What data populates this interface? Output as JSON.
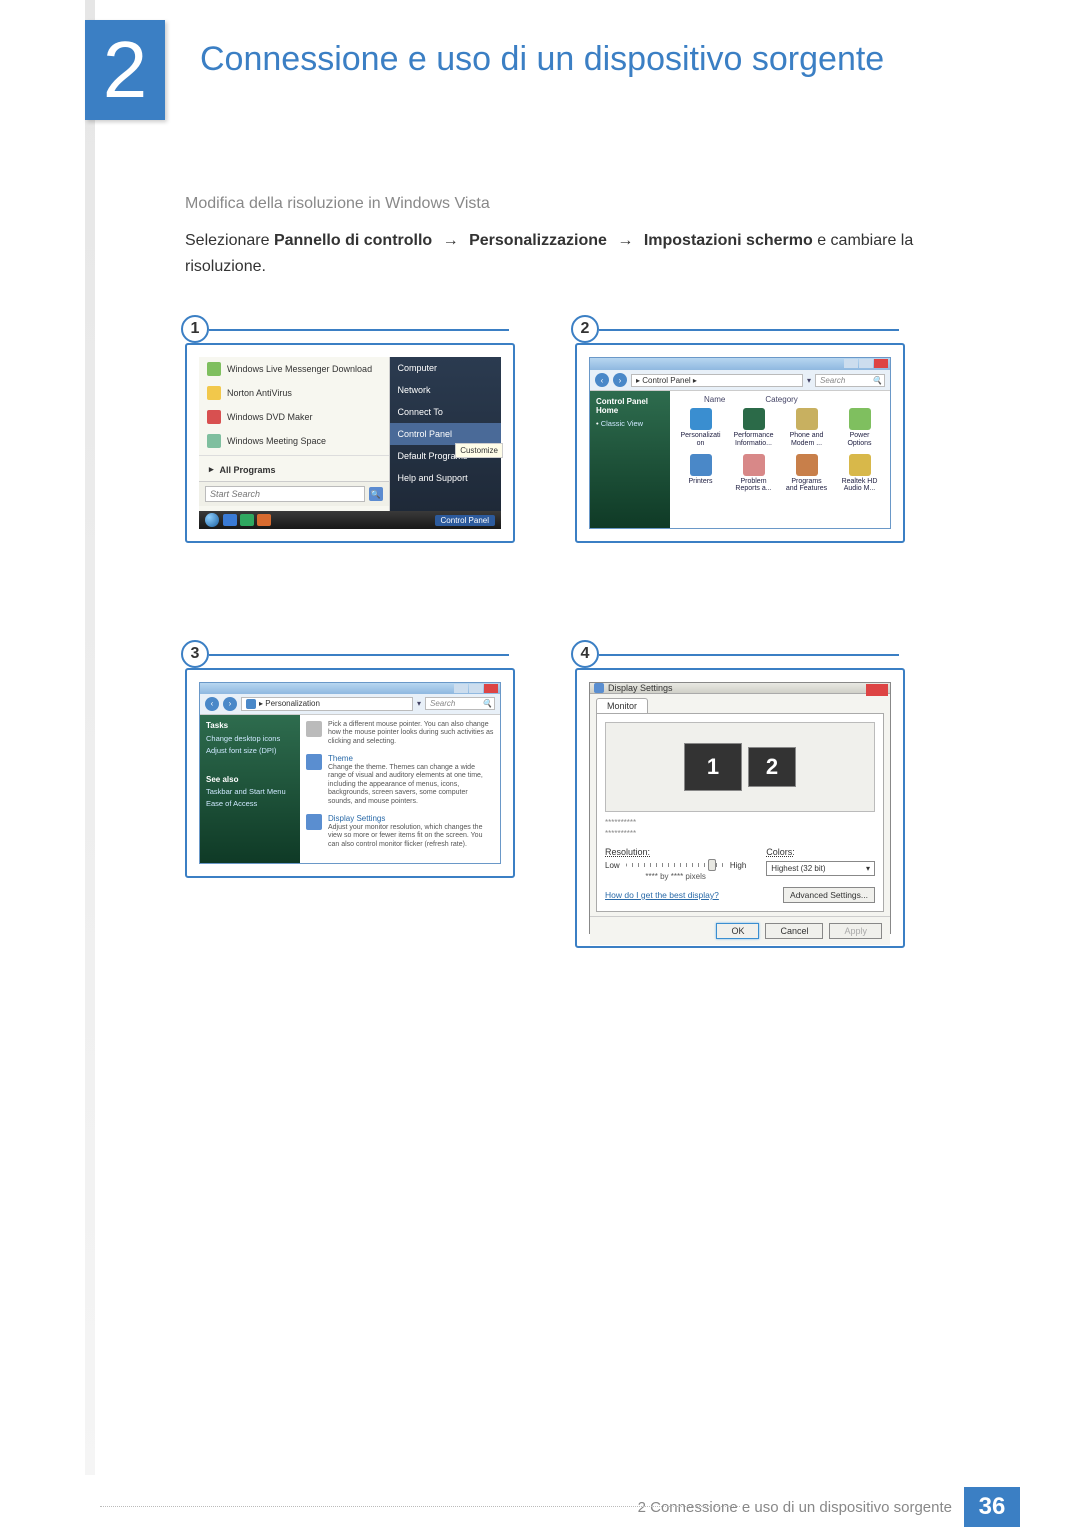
{
  "chapter": {
    "number": "2",
    "title": "Connessione e uso di un dispositivo sorgente"
  },
  "section": {
    "subhead": "Modifica della risoluzione in Windows Vista",
    "text_pre": "Selezionare ",
    "path1": "Pannello di controllo",
    "path2": "Personalizzazione",
    "path3": "Impostazioni schermo",
    "text_post": " e cambiare la risoluzione.",
    "arrow": "→"
  },
  "steps": {
    "s1": "1",
    "s2": "2",
    "s3": "3",
    "s4": "4"
  },
  "fig1": {
    "apps": [
      {
        "name": "Windows Live Messenger Download",
        "color": "#7fbf5f"
      },
      {
        "name": "Norton AntiVirus",
        "color": "#f2c84b"
      },
      {
        "name": "Windows DVD Maker",
        "color": "#d85050"
      },
      {
        "name": "Windows Meeting Space",
        "color": "#7fbf9f"
      }
    ],
    "all_programs": "All Programs",
    "search_placeholder": "Start Search",
    "right_items": [
      "Computer",
      "Network",
      "Connect To",
      "Control Panel",
      "Default Programs",
      "Help and Support"
    ],
    "right_highlight_index": 3,
    "tooltip_text": "Customize",
    "taskbar_label": "Control Panel",
    "tb_colors": [
      "#3a7bd5",
      "#2fa860",
      "#d86b2f"
    ]
  },
  "fig2": {
    "address": "▸ Control Panel ▸",
    "search_placeholder": "Search",
    "sidebar_head": "Control Panel Home",
    "sidebar_link": "Classic View",
    "col_name": "Name",
    "col_category": "Category",
    "icons": [
      {
        "label": "Personalizati\non",
        "color": "#3a8ed0"
      },
      {
        "label": "Performance\nInformatio...",
        "color": "#2b6a48"
      },
      {
        "label": "Phone and\nModem ...",
        "color": "#c8b060"
      },
      {
        "label": "Power\nOptions",
        "color": "#7fbf5f"
      },
      {
        "label": "Printers",
        "color": "#4a88c8"
      },
      {
        "label": "Problem\nReports a...",
        "color": "#d88888"
      },
      {
        "label": "Programs\nand Features",
        "color": "#c87f4a"
      },
      {
        "label": "Realtek HD\nAudio M...",
        "color": "#d8b84a"
      }
    ]
  },
  "fig3": {
    "address": "▸ Personalization",
    "search_placeholder": "Search",
    "sidebar_head": "Tasks",
    "sidebar_links": [
      "Change desktop icons",
      "Adjust font size (DPI)"
    ],
    "seealso_head": "See also",
    "seealso_links": [
      "Taskbar and Start Menu",
      "Ease of Access"
    ],
    "items": [
      {
        "title": "",
        "desc": "Pick a different mouse pointer. You can also change how the mouse pointer looks during such activities as clicking and selecting.",
        "color": "#bbb"
      },
      {
        "title": "Theme",
        "desc": "Change the theme. Themes can change a wide range of visual and auditory elements at one time, including the appearance of menus, icons, backgrounds, screen savers, some computer sounds, and mouse pointers.",
        "color": "#5a8ed0"
      },
      {
        "title": "Display Settings",
        "desc": "Adjust your monitor resolution, which changes the view so more or fewer items fit on the screen. You can also control monitor flicker (refresh rate).",
        "color": "#5a8ed0"
      }
    ]
  },
  "fig4": {
    "title": "Display Settings",
    "tab": "Monitor",
    "mon1": "1",
    "mon2": "2",
    "info1": "**********",
    "info2": "**********",
    "res_label": "Resolution:",
    "res_low": "Low",
    "res_high": "High",
    "res_value": "**** by **** pixels",
    "color_label": "Colors:",
    "color_value": "Highest (32 bit)",
    "link": "How do I get the best display?",
    "adv": "Advanced Settings...",
    "ok": "OK",
    "cancel": "Cancel",
    "apply": "Apply"
  },
  "footer": {
    "text": "2 Connessione e uso di un dispositivo sorgente",
    "page": "36"
  }
}
